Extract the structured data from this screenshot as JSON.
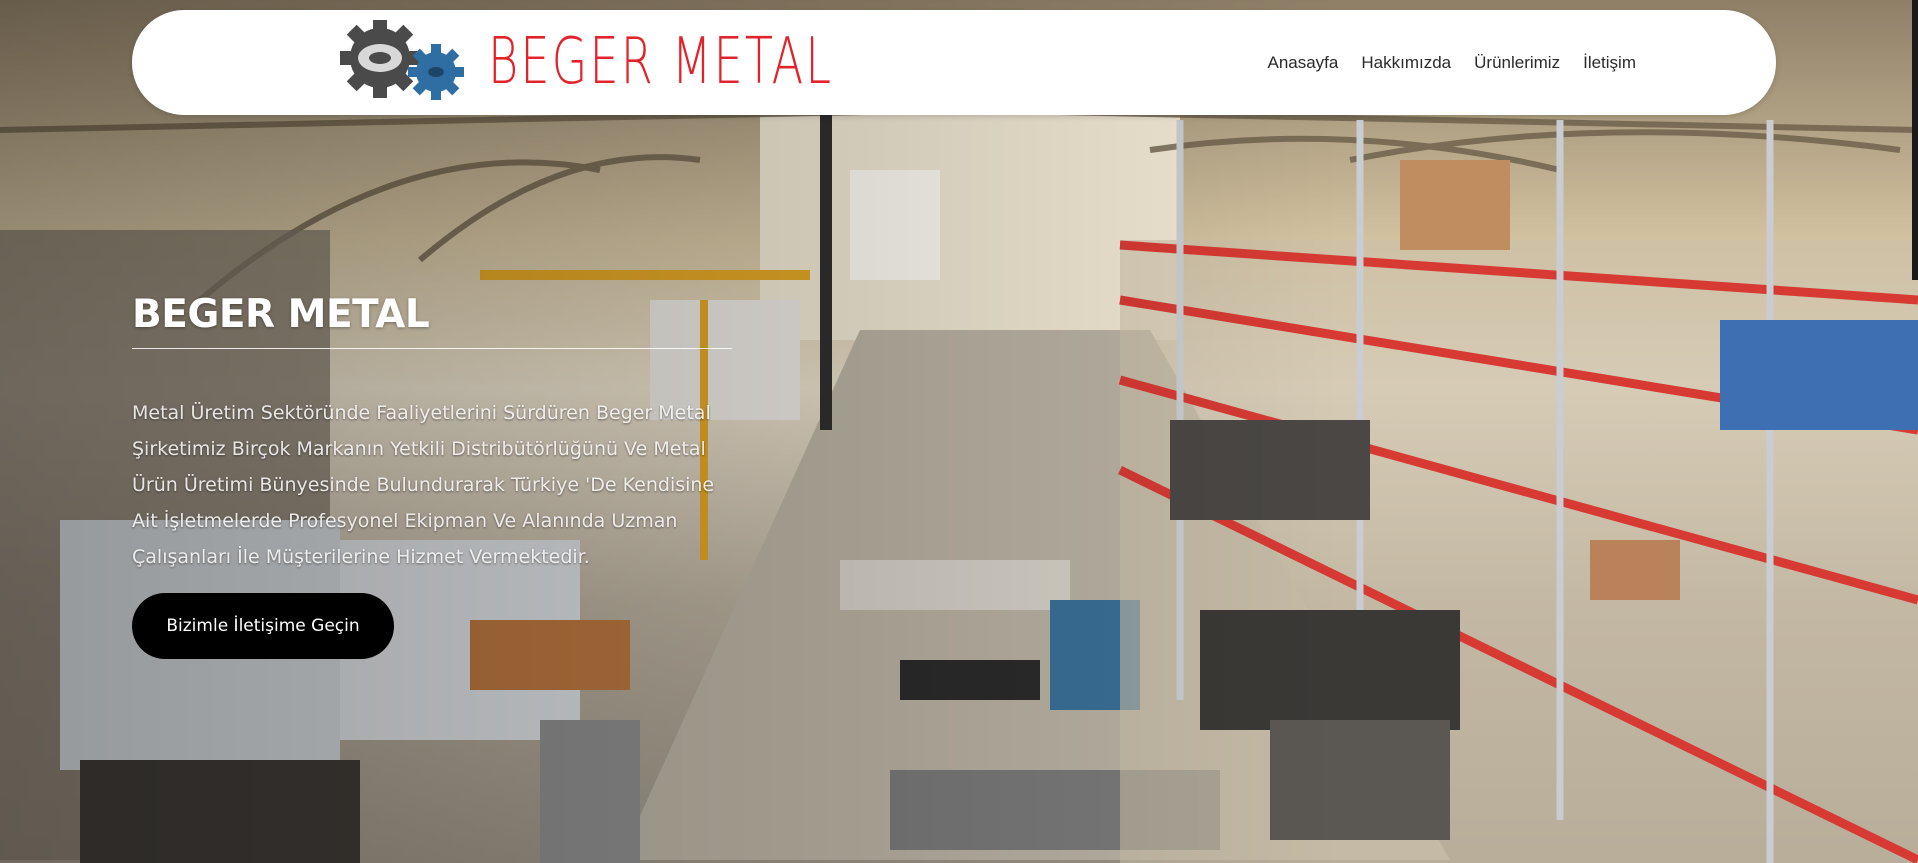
{
  "brand": {
    "name": "BEGER METAL",
    "colors": {
      "brand_red": "#e1242c",
      "gear_gray": "#4a4a4a",
      "gear_blue": "#2f6ea3",
      "button_black": "#000000"
    }
  },
  "nav": {
    "items": [
      {
        "label": "Anasayfa"
      },
      {
        "label": "Hakkımızda"
      },
      {
        "label": "Ürünlerimiz"
      },
      {
        "label": "İletişim"
      }
    ]
  },
  "hero": {
    "title": "BEGER METAL",
    "description": "Metal Üretim Sektöründe Faaliyetlerini Sürdüren Beger Metal Şirketimiz Birçok Markanın Yetkili Distribütörlüğünü Ve Metal Ürün Üretimi Bünyesinde Bulundurarak Türkiye 'De Kendisine Ait İşletmelerde Profesyonel Ekipman Ve Alanında Uzman Çalışanları İle Müşterilerine Hizmet Vermektedir.",
    "cta_label": "Bizimle İletişime Geçin",
    "background_icon": "factory-warehouse-image"
  }
}
